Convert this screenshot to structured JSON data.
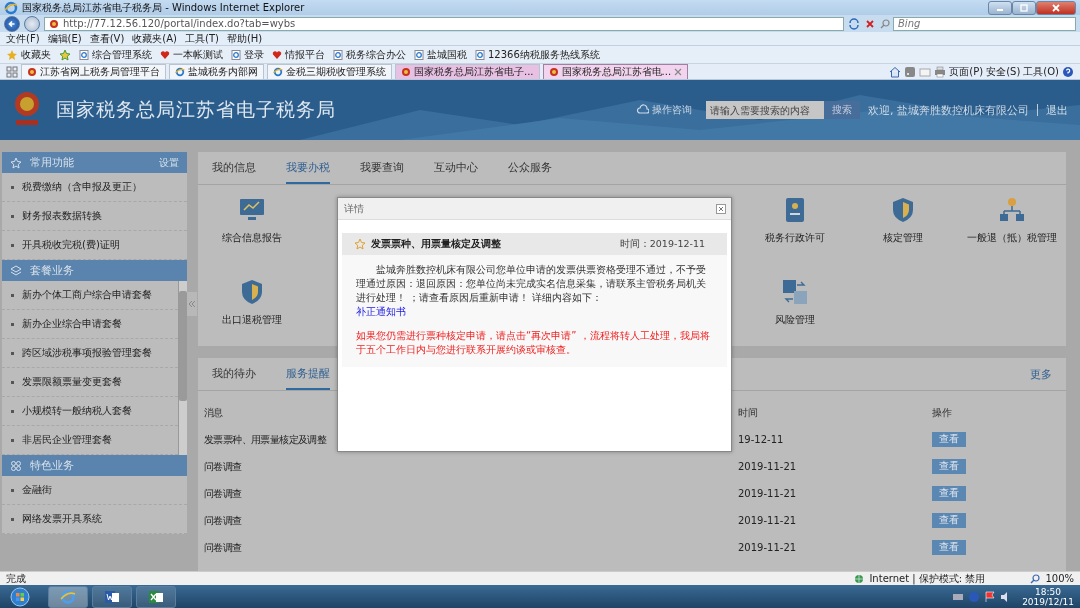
{
  "browser": {
    "title": "国家税务总局江苏省电子税务局 - Windows Internet Explorer",
    "url": "http://77.12.56.120/portal/index.do?tab=wybs",
    "search_placeholder": "Bing",
    "menu": [
      "文件(F)",
      "编辑(E)",
      "查看(V)",
      "收藏夹(A)",
      "工具(T)",
      "帮助(H)"
    ],
    "favorites_label": "收藏夹",
    "favorites": [
      {
        "label": "综合管理系统",
        "kind": "ie"
      },
      {
        "label": "一本帐测试",
        "kind": "emblem"
      },
      {
        "label": "登录",
        "kind": "ie"
      },
      {
        "label": "情报平台",
        "kind": "emblem"
      },
      {
        "label": "税务综合办公",
        "kind": "ie"
      },
      {
        "label": "盐城国税",
        "kind": "ie"
      },
      {
        "label": "12366纳税服务热线系统",
        "kind": "ie"
      }
    ],
    "tabs": [
      {
        "label": "江苏省网上税务局管理平台",
        "kind": "emblem",
        "selected": false,
        "highlight": false
      },
      {
        "label": "盐城税务内部网",
        "kind": "ie",
        "selected": false,
        "highlight": false
      },
      {
        "label": "金税三期税收管理系统",
        "kind": "ie",
        "selected": false,
        "highlight": false
      },
      {
        "label": "国家税务总局江苏省电子...",
        "kind": "emblem",
        "selected": false,
        "highlight": true
      },
      {
        "label": "国家税务总局江苏省电...",
        "kind": "emblem",
        "selected": true,
        "highlight": true
      }
    ],
    "commands": [
      "页面(P)",
      "安全(S)",
      "工具(O)"
    ]
  },
  "site": {
    "title": "国家税务总局江苏省电子税务局",
    "help": "操作咨询",
    "search_placeholder": "请输入需要搜索的内容",
    "search_button": "搜索",
    "welcome": "欢迎, 盐城奔胜数控机床有限公司",
    "logout": "退出"
  },
  "sidebar": [
    {
      "title": "常用功能",
      "kind": "star",
      "action": "设置",
      "scroll": false,
      "items": [
        "税费缴纳（含申报及更正）",
        "财务报表数据转换",
        "开具税收完税(费)证明"
      ]
    },
    {
      "title": "套餐业务",
      "kind": "layers",
      "scroll": true,
      "items": [
        "新办个体工商户综合申请套餐",
        "新办企业综合申请套餐",
        "跨区域涉税事项报验管理套餐",
        "发票限额票量变更套餐",
        "小规模转一般纳税人套餐",
        "非居民企业管理套餐"
      ]
    },
    {
      "title": "特色业务",
      "kind": "grid",
      "scroll": false,
      "items": [
        "金融街",
        "网络发票开具系统"
      ]
    }
  ],
  "main_tabs": [
    {
      "label": "我的信息",
      "selected": false
    },
    {
      "label": "我要办税",
      "selected": true
    },
    {
      "label": "我要查询",
      "selected": false
    },
    {
      "label": "互动中心",
      "selected": false
    },
    {
      "label": "公众服务",
      "selected": false
    }
  ],
  "services": [
    {
      "left": [
        {
          "label": "综合信息报告",
          "kind": "monitor"
        }
      ],
      "right": [
        {
          "label": "税务行政许可",
          "kind": "document"
        },
        {
          "label": "核定管理",
          "kind": "shield"
        },
        {
          "label": "一般退（抵）税管理",
          "kind": "network"
        }
      ]
    },
    {
      "left": [
        {
          "label": "出口退税管理",
          "kind": "shield"
        }
      ],
      "right": [
        {
          "label": "风险管理",
          "kind": "translate"
        }
      ]
    }
  ],
  "bottom_tabs": [
    {
      "label": "我的待办",
      "selected": false
    },
    {
      "label": "服务提醒",
      "selected": true
    }
  ],
  "more": "更多",
  "table": {
    "columns": [
      "消息",
      "时间",
      "操作"
    ],
    "rows": [
      {
        "message": "发票票种、用票量核定及调整",
        "date": "19-12-11",
        "action": "查看"
      },
      {
        "message": "问卷调查",
        "date": "2019-11-21",
        "action": "查看"
      },
      {
        "message": "问卷调查",
        "date": "2019-11-21",
        "action": "查看"
      },
      {
        "message": "问卷调查",
        "date": "2019-11-21",
        "action": "查看"
      },
      {
        "message": "问卷调查",
        "date": "2019-11-21",
        "action": "查看"
      }
    ]
  },
  "modal": {
    "title": "详情",
    "notice_title": "发票票种、用票量核定及调整",
    "time": "时间：2019-12-11",
    "body": "盐城奔胜数控机床有限公司您单位申请的发票供票资格受理不通过，不予受理通过原因：退回原因：您单位尚未完成实名信息采集，请联系主管税务局机关进行处理！ ；请查看原因后重新申请！ 详细内容如下：",
    "link": "补正通知书",
    "warning": "如果您仍需进行票种核定申请，请点击“再次申请” ，流程将转人工处理，我局将于五个工作日内与您进行联系开展约谈或审核查。"
  },
  "status_bar": {
    "text": "完成",
    "zone": "Internet | 保护模式: 禁用",
    "zoom": "100%"
  },
  "taskbar": {
    "apps": [
      {
        "kind": "ie",
        "selected": true
      },
      {
        "kind": "word",
        "selected": false
      },
      {
        "kind": "excel",
        "selected": false
      }
    ],
    "time": "18:50",
    "date": "2019/12/11"
  }
}
